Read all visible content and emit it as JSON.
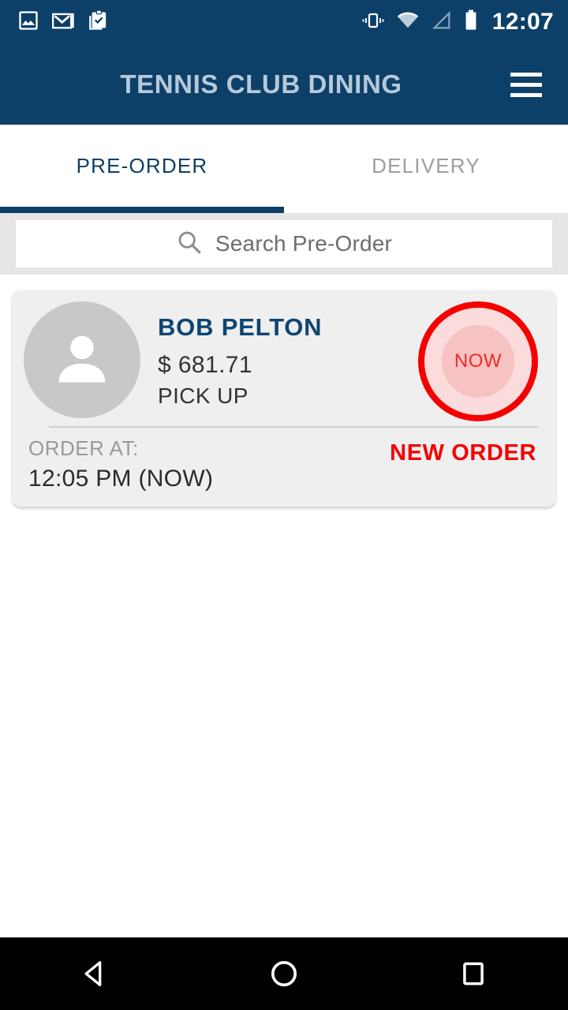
{
  "status_bar": {
    "icons_left": [
      "image-icon",
      "gmail-icon",
      "clipboard-check-icon"
    ],
    "icons_right": [
      "vibrate-icon",
      "wifi-icon",
      "signal-icon",
      "battery-icon"
    ],
    "clock": "12:07"
  },
  "app_bar": {
    "title": "TENNIS CLUB DINING",
    "menu_icon": "hamburger-menu-icon",
    "background_color": "#0d4068",
    "title_color": "#b6c9da"
  },
  "tabs": [
    {
      "label": "PRE-ORDER",
      "active": true
    },
    {
      "label": "DELIVERY",
      "active": false
    }
  ],
  "search": {
    "icon": "search-icon",
    "placeholder": "Search Pre-Order",
    "value": ""
  },
  "orders": [
    {
      "avatar_icon": "person-avatar-icon",
      "customer_name": "BOB PELTON",
      "price": "$ 681.71",
      "order_type": "PICK UP",
      "action_label": "NOW",
      "order_at_label": "ORDER AT:",
      "order_at_time": "12:05 PM (NOW)",
      "status_badge": "NEW ORDER",
      "accent_color": "#f40000"
    }
  ],
  "nav_bar": {
    "back_icon": "back-triangle-icon",
    "home_icon": "home-circle-icon",
    "recents_icon": "recents-square-icon"
  }
}
